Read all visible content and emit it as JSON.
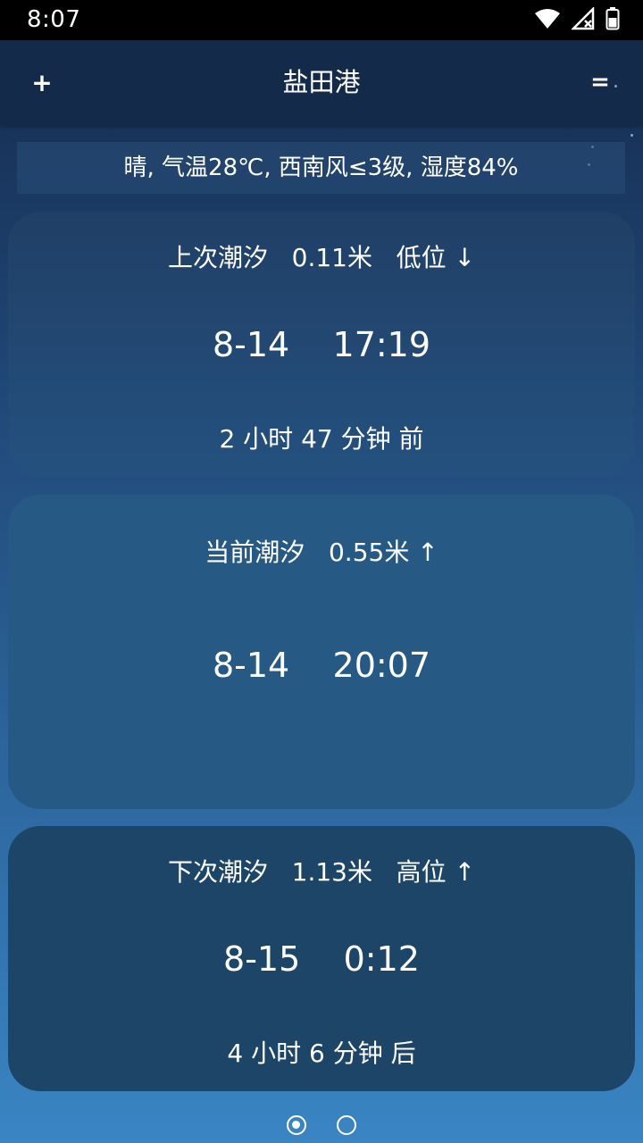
{
  "status_bar": {
    "time": "8:07",
    "icons": [
      "wifi-icon",
      "signal-off-icon",
      "battery-icon"
    ]
  },
  "app_bar": {
    "title": "盐田港",
    "add_label": "+",
    "menu_label": "="
  },
  "weather": {
    "summary": "晴, 气温28℃, 西南风≤3级, 湿度84%"
  },
  "tides": {
    "previous": {
      "header": "上次潮汐   0.11米   低位 ↓",
      "datetime": "8-14    17:19",
      "relative": "2 小时 47 分钟 前"
    },
    "current": {
      "header": "当前潮汐   0.55米 ↑",
      "datetime": "8-14    20:07"
    },
    "next": {
      "header": "下次潮汐   1.13米   高位 ↑",
      "datetime": "8-15    0:12",
      "relative": "4 小时 6 分钟 后"
    }
  },
  "pager": {
    "pages": 2,
    "active_index": 0
  },
  "colors": {
    "status_bar": "#000000",
    "app_bar": "#142a4b",
    "text": "#ffffff"
  }
}
